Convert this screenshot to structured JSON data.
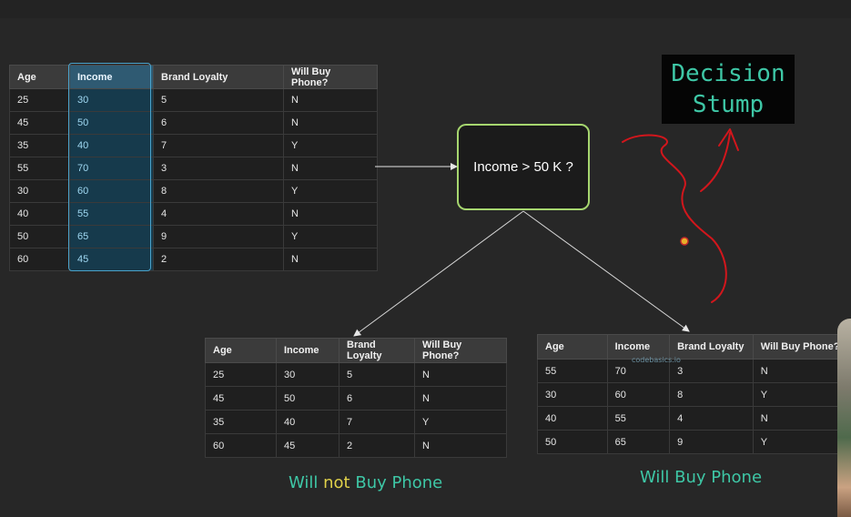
{
  "main_table": {
    "headers": [
      "Age",
      "Income",
      "Brand Loyalty",
      "Will Buy Phone?"
    ],
    "rows": [
      [
        "25",
        "30",
        "5",
        "N"
      ],
      [
        "45",
        "50",
        "6",
        "N"
      ],
      [
        "35",
        "40",
        "7",
        "Y"
      ],
      [
        "55",
        "70",
        "3",
        "N"
      ],
      [
        "30",
        "60",
        "8",
        "Y"
      ],
      [
        "40",
        "55",
        "4",
        "N"
      ],
      [
        "50",
        "65",
        "9",
        "Y"
      ],
      [
        "60",
        "45",
        "2",
        "N"
      ]
    ]
  },
  "decision_node": {
    "label": "Income > 50 K ?"
  },
  "title_box": {
    "line1": "Decision",
    "line2": "Stump"
  },
  "left_table": {
    "headers": [
      "Age",
      "Income",
      "Brand Loyalty",
      "Will Buy Phone?"
    ],
    "rows": [
      [
        "25",
        "30",
        "5",
        "N"
      ],
      [
        "45",
        "50",
        "6",
        "N"
      ],
      [
        "35",
        "40",
        "7",
        "Y"
      ],
      [
        "60",
        "45",
        "2",
        "N"
      ]
    ]
  },
  "right_table": {
    "headers": [
      "Age",
      "Income",
      "Brand Loyalty",
      "Will Buy Phone?"
    ],
    "rows": [
      [
        "55",
        "70",
        "3",
        "N"
      ],
      [
        "30",
        "60",
        "8",
        "Y"
      ],
      [
        "40",
        "55",
        "4",
        "N"
      ],
      [
        "50",
        "65",
        "9",
        "Y"
      ]
    ]
  },
  "outcomes": {
    "left": {
      "part1": "Will ",
      "part2": "not",
      "part3": " Buy Phone"
    },
    "right": "Will Buy Phone"
  },
  "watermark": "codebasics.io",
  "colors": {
    "highlight_column": "#163a4c",
    "node_border": "#a6d66f",
    "title_text": "#3ec7a6",
    "annotation_red": "#d2161c",
    "negation_yellow": "#e0d14a"
  }
}
